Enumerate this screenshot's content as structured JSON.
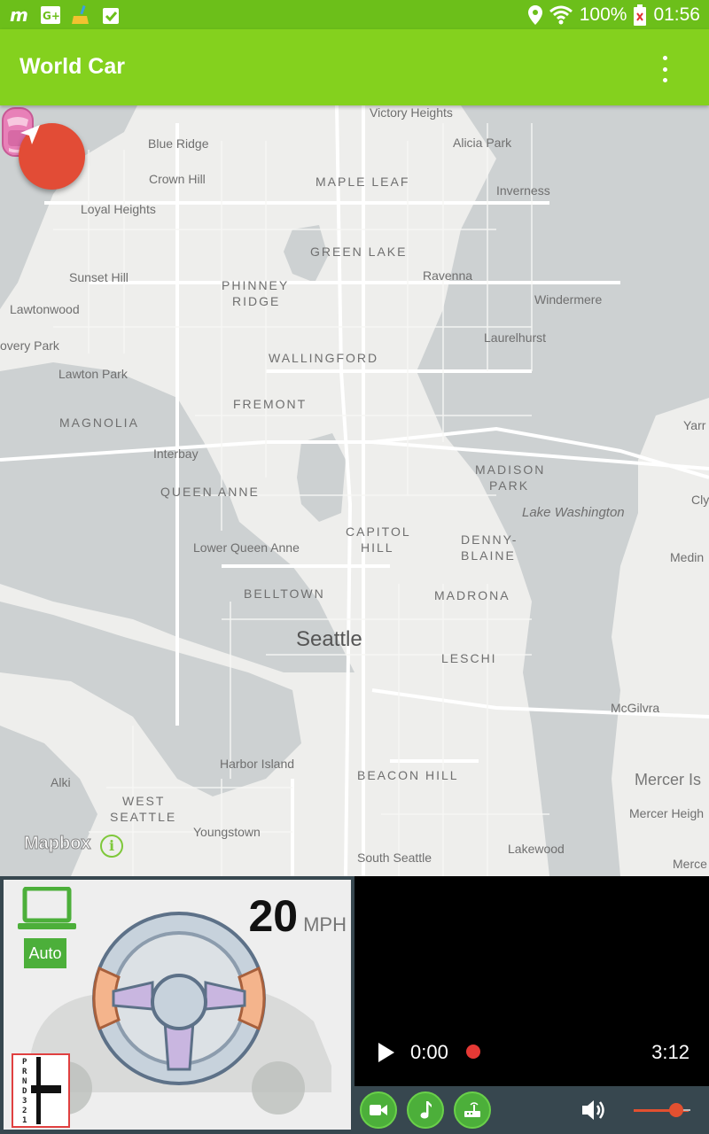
{
  "status_bar": {
    "battery": "100%",
    "time": "01:56",
    "icons": [
      "m-app-icon",
      "google-plus-icon",
      "broom-icon",
      "clipboard-check-icon",
      "location-pin-icon",
      "wifi-icon",
      "battery-icon"
    ]
  },
  "app_bar": {
    "title": "World Car",
    "menu_icon": "overflow-menu-icon"
  },
  "map": {
    "labels": {
      "victory_heights": "Victory Heights",
      "blue_ridge": "Blue Ridge",
      "alicia_park": "Alicia Park",
      "crown_hill": "Crown Hill",
      "maple_leaf": "MAPLE LEAF",
      "inverness": "Inverness",
      "loyal_heights": "Loyal Heights",
      "green_lake": "GREEN LAKE",
      "sunset_hill": "Sunset Hill",
      "ravenna": "Ravenna",
      "phinney_ridge_1": "PHINNEY",
      "phinney_ridge_2": "RIDGE",
      "windermere": "Windermere",
      "lawtonwood": "Lawtonwood",
      "laurelhurst": "Laurelhurst",
      "discovery_park": "overy Park",
      "wallingford": "WALLINGFORD",
      "lawton_park": "Lawton Park",
      "fremont": "FREMONT",
      "magnolia": "MAGNOLIA",
      "yarrow": "Yarr",
      "interbay": "Interbay",
      "madison_park_1": "MADISON",
      "madison_park_2": "PARK",
      "queen_anne": "QUEEN ANNE",
      "lake_washington": "Lake Washington",
      "clyde": "Cly",
      "capitol_hill_1": "CAPITOL",
      "capitol_hill_2": "HILL",
      "denny_blaine_1": "DENNY-",
      "denny_blaine_2": "BLAINE",
      "lower_queen_anne": "Lower Queen Anne",
      "medina": "Medin",
      "belltown": "BELLTOWN",
      "madrona": "MADRONA",
      "seattle": "Seattle",
      "leschi": "LESCHI",
      "mcgilvra": "McGilvra",
      "harbor_island": "Harbor Island",
      "alki": "Alki",
      "beacon_hill": "BEACON HILL",
      "mercer_island": "Mercer Is",
      "west_seattle_1": "WEST",
      "west_seattle_2": "SEATTLE",
      "mercer_heights": "Mercer Heigh",
      "youngstown": "Youngstown",
      "south_seattle": "South Seattle",
      "lakewood": "Lakewood",
      "mercer_sw": "Merce"
    },
    "attribution": "Mapbox",
    "locate_button_icon": "navigation-arrow-icon"
  },
  "dashboard": {
    "speed": "20",
    "speed_unit": "MPH",
    "mode": "Auto",
    "gear_positions": "PRND321",
    "colors": {
      "accent_green": "#4caf3a",
      "appbar": "#84d11e",
      "fab": "#e24c36"
    }
  },
  "player": {
    "current_time": "0:00",
    "duration": "3:12",
    "volume_level": 0.75
  }
}
